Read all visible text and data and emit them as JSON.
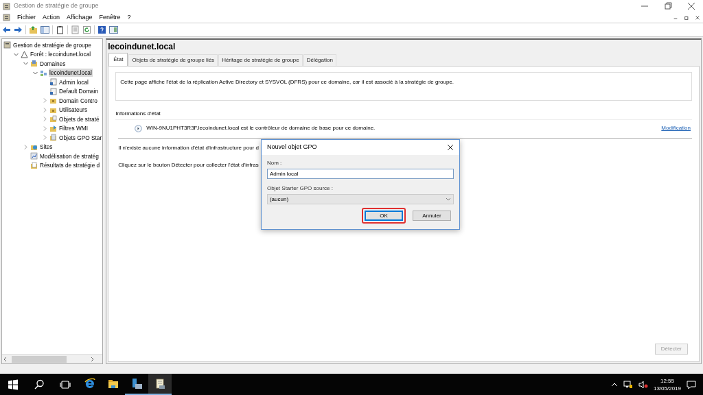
{
  "window": {
    "title": "Gestion de stratégie de groupe"
  },
  "menu": [
    "Fichier",
    "Action",
    "Affichage",
    "Fenêtre",
    "?"
  ],
  "tree": [
    {
      "label": "Gestion de stratégie de groupe",
      "kind": "root",
      "children": [
        {
          "label": "Forêt : lecoindunet.local",
          "kind": "forest",
          "expanded": true,
          "children": [
            {
              "label": "Domaines",
              "kind": "domains",
              "expanded": true,
              "children": [
                {
                  "label": "lecoindunet.local",
                  "kind": "domain",
                  "expanded": true,
                  "selected": true,
                  "children": [
                    {
                      "label": "Admin local",
                      "kind": "gpo",
                      "selected": false
                    },
                    {
                      "label": "Default Domain",
                      "kind": "gpo",
                      "selected": false
                    },
                    {
                      "label": "Domain Contro",
                      "kind": "ou",
                      "expanded": false,
                      "selected": false
                    },
                    {
                      "label": "Utilisateurs",
                      "kind": "ou",
                      "expanded": false,
                      "selected": false
                    },
                    {
                      "label": "Objets de straté",
                      "kind": "gpo-folder",
                      "expanded": false,
                      "selected": false
                    },
                    {
                      "label": "Filtres WMI",
                      "kind": "wmi",
                      "expanded": false,
                      "selected": false
                    },
                    {
                      "label": "Objets GPO Star",
                      "kind": "starter",
                      "expanded": false,
                      "selected": false
                    }
                  ]
                }
              ]
            },
            {
              "label": "Sites",
              "kind": "sites",
              "expanded": false,
              "selected": false
            },
            {
              "label": "Modélisation de stratég",
              "kind": "modeling",
              "selected": false
            },
            {
              "label": "Résultats de stratégie d",
              "kind": "results",
              "selected": false
            }
          ]
        }
      ]
    }
  ],
  "pane": {
    "title": "lecoindunet.local",
    "tabs": [
      {
        "label": "État",
        "selected": true
      },
      {
        "label": "Objets de stratégie de groupe liés",
        "selected": false
      },
      {
        "label": "Héritage de stratégie de groupe",
        "selected": false
      },
      {
        "label": "Délégation",
        "selected": false
      }
    ],
    "description": "Cette page affiche l'état de la réplication Active Directory et SYSVOL (DFRS) pour ce domaine, car il est associé à la stratégie de groupe.",
    "status_section": {
      "legend": "Informations d'état",
      "message": "WIN-9NU1PHT3R3F.lecoindunet.local est le contrôleur de domaine de base pour ce domaine.",
      "link": "Modification"
    },
    "notes": [
      "Il n'existe aucune information d'état d'infrastructure pour d",
      "Cliquez sur le bouton Détecter pour collecter l'état d'infras"
    ],
    "detect_button": {
      "label": "Détecter",
      "disabled": true
    }
  },
  "dialog": {
    "title": "Nouvel objet GPO",
    "name_label": "Nom :",
    "name_value": "Admin local",
    "source_label": "Objet Starter GPO source :",
    "source_value": "(aucun)",
    "buttons": [
      {
        "label": "OK",
        "highlighted": true
      },
      {
        "label": "Annuler",
        "highlighted": false
      }
    ]
  },
  "taskbar": {
    "apps": [
      {
        "kind": "browser",
        "running": false,
        "selected": false
      },
      {
        "kind": "explorer",
        "running": false,
        "selected": false
      },
      {
        "kind": "server",
        "running": true,
        "selected": false
      },
      {
        "kind": "gpmc",
        "running": true,
        "selected": true
      }
    ],
    "time": "12:55",
    "date": "13/05/2019"
  }
}
